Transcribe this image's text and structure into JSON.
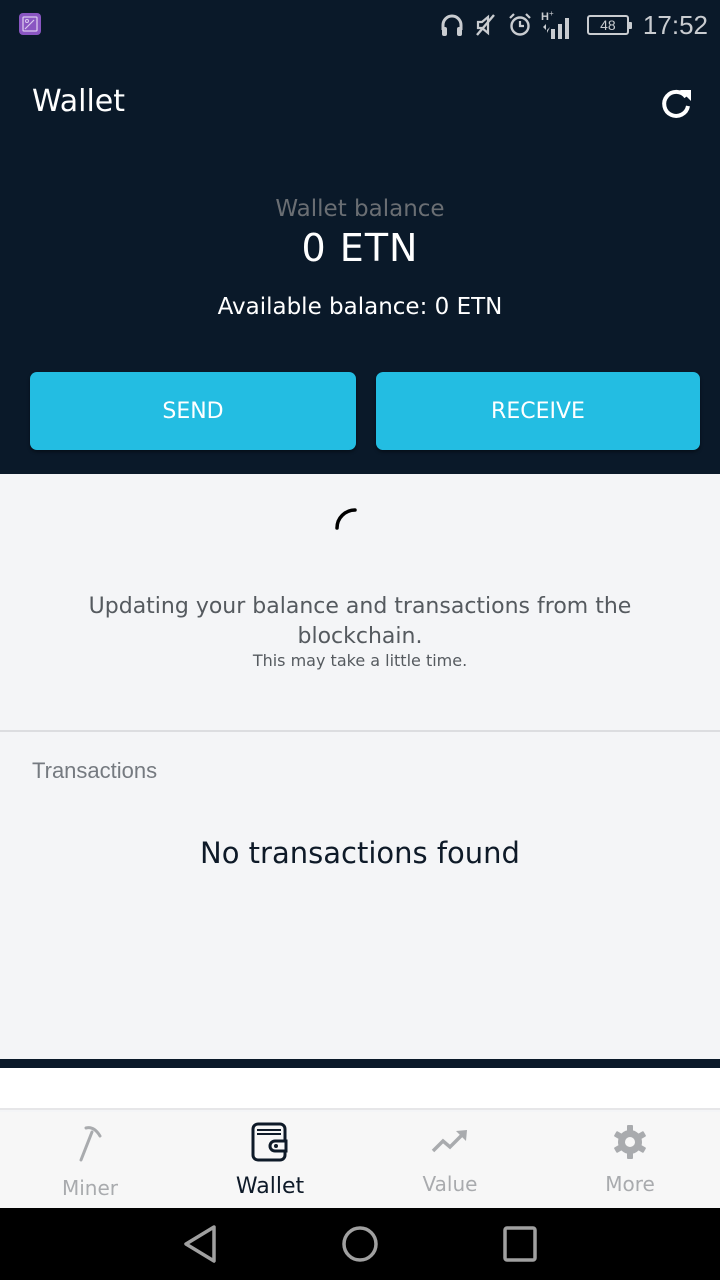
{
  "status_bar": {
    "icons": [
      "gallery-notification-icon",
      "headphones-icon",
      "mute-icon",
      "alarm-icon",
      "signal-icon"
    ],
    "network_type": "H+",
    "battery_level": "48",
    "time": "17:52"
  },
  "header": {
    "title": "Wallet",
    "refresh_icon": "refresh-icon",
    "balance_label": "Wallet balance",
    "balance_value": "0 ETN",
    "available_balance": "Available balance: 0 ETN"
  },
  "actions": {
    "send_label": "SEND",
    "receive_label": "RECEIVE"
  },
  "sync": {
    "message": "Updating your balance and transactions from the blockchain.",
    "submessage": "This may take a little time."
  },
  "transactions": {
    "section_label": "Transactions",
    "empty_message": "No transactions found",
    "items": []
  },
  "bottom_nav": {
    "items": [
      {
        "label": "Miner",
        "icon": "pickaxe-icon",
        "active": false
      },
      {
        "label": "Wallet",
        "icon": "wallet-icon",
        "active": true
      },
      {
        "label": "Value",
        "icon": "trending-up-icon",
        "active": false
      },
      {
        "label": "More",
        "icon": "gear-icon",
        "active": false
      }
    ]
  },
  "colors": {
    "header_bg": "#0a1929",
    "accent": "#23bde2",
    "content_bg": "#f4f5f7",
    "nav_active": "#0e1a28",
    "nav_inactive": "#a9abae"
  }
}
